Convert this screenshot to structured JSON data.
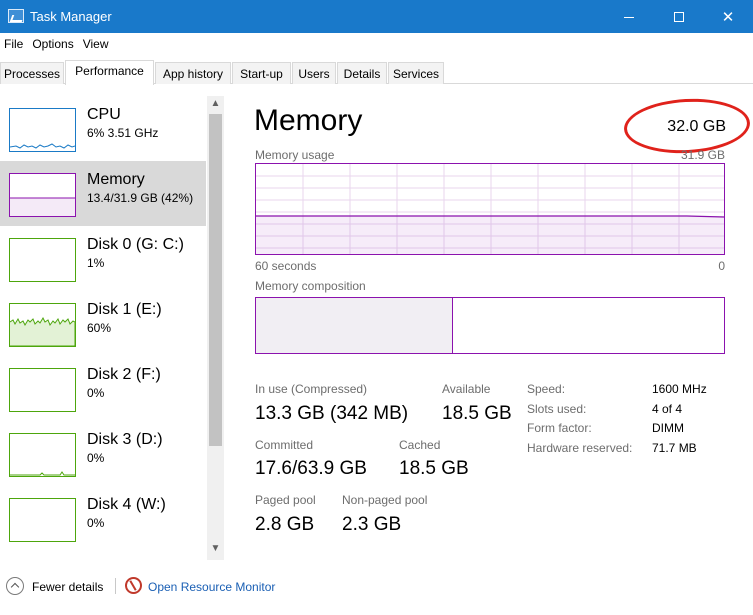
{
  "window": {
    "title": "Task Manager"
  },
  "menu": [
    "File",
    "Options",
    "View"
  ],
  "tabs": [
    "Processes",
    "Performance",
    "App history",
    "Start-up",
    "Users",
    "Details",
    "Services"
  ],
  "sidebar": {
    "items": [
      {
        "name": "CPU",
        "sub": "6% 3.51 GHz",
        "color": "#1a7ac6"
      },
      {
        "name": "Memory",
        "sub": "13.4/31.9 GB (42%)",
        "color": "#8b12ae"
      },
      {
        "name": "Disk 0 (G: C:)",
        "sub": "1%",
        "color": "#4da60c"
      },
      {
        "name": "Disk 1 (E:)",
        "sub": "60%",
        "color": "#4da60c"
      },
      {
        "name": "Disk 2 (F:)",
        "sub": "0%",
        "color": "#4da60c"
      },
      {
        "name": "Disk 3 (D:)",
        "sub": "0%",
        "color": "#4da60c"
      },
      {
        "name": "Disk 4 (W:)",
        "sub": "0%",
        "color": "#4da60c"
      }
    ]
  },
  "main": {
    "title": "Memory",
    "total": "32.0 GB",
    "usage_label": "Memory usage",
    "usage_max": "31.9 GB",
    "time_left": "60 seconds",
    "time_right": "0",
    "composition_label": "Memory composition",
    "usage_fraction": 0.42,
    "stats": {
      "in_use_label": "In use (Compressed)",
      "in_use_value": "13.3 GB (342 MB)",
      "available_label": "Available",
      "available_value": "18.5 GB",
      "committed_label": "Committed",
      "committed_value": "17.6/63.9 GB",
      "cached_label": "Cached",
      "cached_value": "18.5 GB",
      "paged_label": "Paged pool",
      "paged_value": "2.8 GB",
      "nonpaged_label": "Non-paged pool",
      "nonpaged_value": "2.3 GB"
    },
    "specs": [
      {
        "label": "Speed:",
        "value": "1600 MHz"
      },
      {
        "label": "Slots used:",
        "value": "4 of 4"
      },
      {
        "label": "Form factor:",
        "value": "DIMM"
      },
      {
        "label": "Hardware reserved:",
        "value": "71.7 MB"
      }
    ]
  },
  "footer": {
    "fewer_details": "Fewer details",
    "open_resource_monitor": "Open Resource Monitor"
  },
  "colors": {
    "accent": "#1979ca",
    "memory": "#8b12ae",
    "disk": "#4da60c",
    "cpu": "#1a7ac6"
  }
}
